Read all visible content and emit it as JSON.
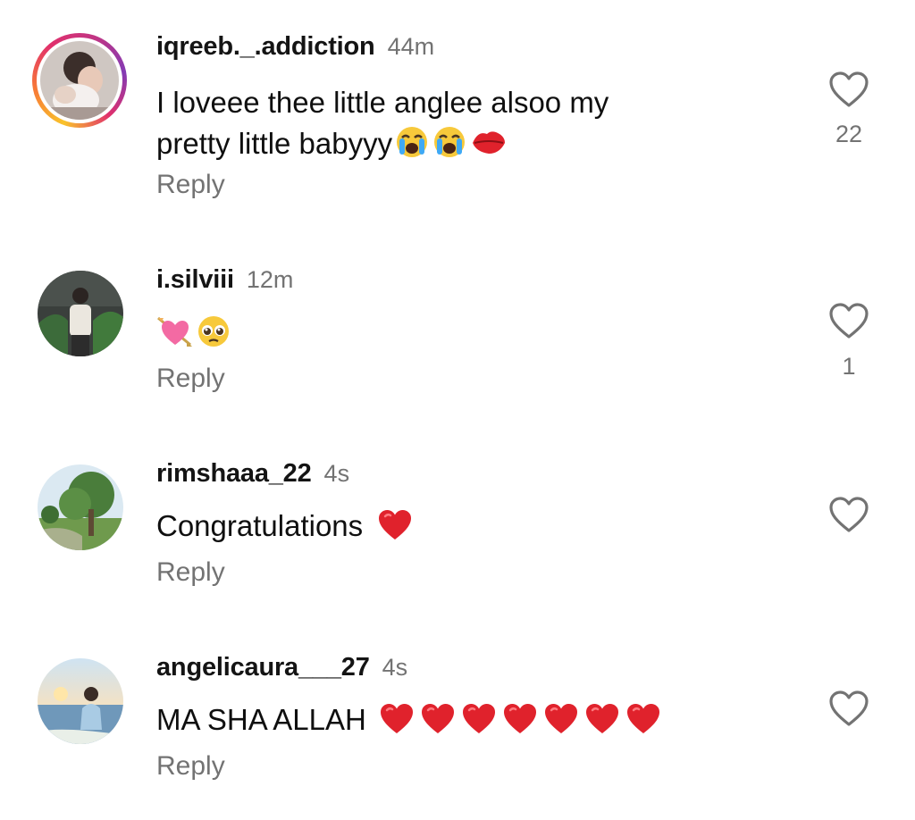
{
  "comments": [
    {
      "username": "iqreeb._.addiction",
      "time": "44m",
      "text_line1": "I loveee thee little anglee alsoo my",
      "text_line2": "pretty little babyyy",
      "emojis": [
        "loudly-crying-face",
        "loudly-crying-face",
        "kiss-mark"
      ],
      "reply_label": "Reply",
      "likes": "22",
      "has_story_ring": true
    },
    {
      "username": "i.silviii",
      "time": "12m",
      "text": "",
      "emojis": [
        "heart-with-arrow",
        "pleading-face"
      ],
      "reply_label": "Reply",
      "likes": "1"
    },
    {
      "username": "rimshaaa_22",
      "time": "4s",
      "text": "Congratulations",
      "emojis": [
        "red-heart"
      ],
      "reply_label": "Reply",
      "likes": ""
    },
    {
      "username": "angelicaura___27",
      "time": "4s",
      "text": "MA SHA ALLAH",
      "emojis": [
        "red-heart",
        "red-heart",
        "red-heart",
        "red-heart",
        "red-heart",
        "red-heart",
        "red-heart"
      ],
      "reply_label": "Reply",
      "likes": ""
    }
  ],
  "colors": {
    "username": "#141414",
    "secondary": "#737373",
    "heart_emoji": "#e0222c"
  }
}
